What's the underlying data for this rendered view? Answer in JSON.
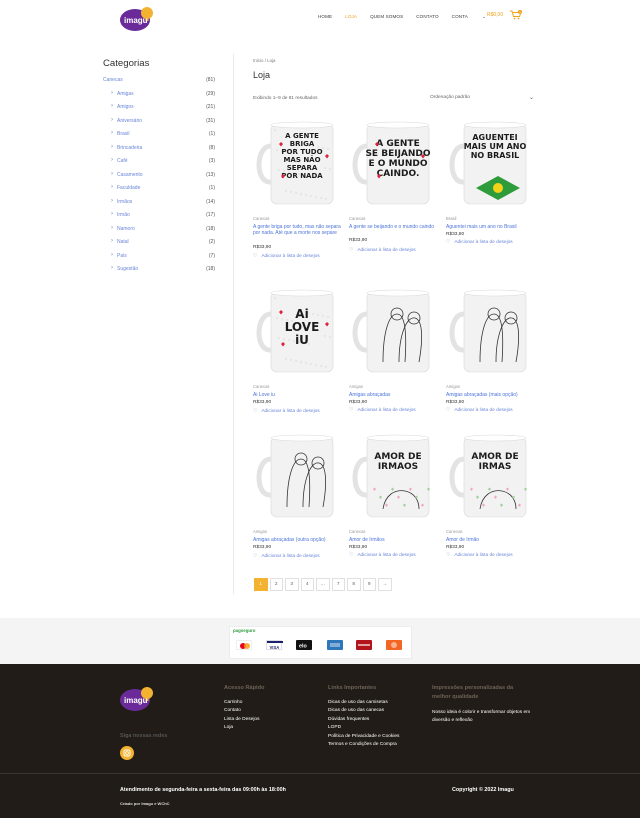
{
  "header": {
    "logo_text": "imagu",
    "nav": [
      "HOME",
      "LOJA",
      "QUEM SOMOS",
      "CONTATO",
      "CONTA"
    ],
    "cart_total": "R$0,00",
    "cart_count": "0"
  },
  "sidebar": {
    "title": "Categorias",
    "items": [
      {
        "label": "Canecas",
        "count": "(81)",
        "sub": false
      },
      {
        "label": "Amigas",
        "count": "(29)",
        "sub": true
      },
      {
        "label": "Amigos",
        "count": "(21)",
        "sub": true
      },
      {
        "label": "Aniversário",
        "count": "(31)",
        "sub": true
      },
      {
        "label": "Brasil",
        "count": "(1)",
        "sub": true
      },
      {
        "label": "Brincadeira",
        "count": "(8)",
        "sub": true
      },
      {
        "label": "Café",
        "count": "(3)",
        "sub": true
      },
      {
        "label": "Casamento",
        "count": "(13)",
        "sub": true
      },
      {
        "label": "Faculdade",
        "count": "(1)",
        "sub": true
      },
      {
        "label": "Irmãos",
        "count": "(14)",
        "sub": true
      },
      {
        "label": "Irmão",
        "count": "(17)",
        "sub": true
      },
      {
        "label": "Namoro",
        "count": "(18)",
        "sub": true
      },
      {
        "label": "Natal",
        "count": "(2)",
        "sub": true
      },
      {
        "label": "Pais",
        "count": "(7)",
        "sub": true
      },
      {
        "label": "Sugestão",
        "count": "(18)",
        "sub": true
      }
    ]
  },
  "main": {
    "breadcrumb": "Início / Loja",
    "title": "Loja",
    "results": "Exibindo 1–9 de 81 resultados",
    "ordering": "Ordenação padrão",
    "wishlist_label": "Adicionar à lista de desejos",
    "products": [
      {
        "cat": "Canecas",
        "name": "A gente briga por tudo, mas não separa por nada. Até que a morte nos separe",
        "price": "R$33,90",
        "mug_text": [
          "A GENTE",
          "BRIGA",
          "POR TUDO",
          "MAS NÃO",
          "SEPARA",
          "POR NADA"
        ]
      },
      {
        "cat": "Canecas",
        "name": "A gente se beijando e o mundo caindo",
        "price": "R$33,90",
        "mug_text": [
          "A GENTE",
          "SE BEIJANDO",
          "E O MUNDO",
          "CAINDO."
        ]
      },
      {
        "cat": "Brasil",
        "name": "Aguentei mais um ano no Brasil",
        "price": "R$33,90",
        "mug_text": [
          "AGUENTEI",
          "MAIS UM ANO",
          "NO BRASIL"
        ]
      },
      {
        "cat": "Canecas",
        "name": "Ai Love iu",
        "price": "R$33,90",
        "mug_text": [
          "Ai",
          "LOVE",
          "iU"
        ]
      },
      {
        "cat": "Amigas",
        "name": "Amigas abraçadas",
        "price": "R$33,90",
        "mug_text": []
      },
      {
        "cat": "Amigas",
        "name": "Amigas abraçadas (mais opção)",
        "price": "R$33,90",
        "mug_text": []
      },
      {
        "cat": "Amigas",
        "name": "Amigas abraçadas (outra opção)",
        "price": "R$33,90",
        "mug_text": []
      },
      {
        "cat": "Canecas",
        "name": "Amor de Irmãos",
        "price": "R$33,90",
        "mug_text": [
          "AMOR DE",
          "IRMAOS"
        ]
      },
      {
        "cat": "Canecas",
        "name": "Amor de Irmão",
        "price": "R$33,90",
        "mug_text": [
          "AMOR DE",
          "IRMAS"
        ]
      }
    ],
    "pages": [
      "1",
      "2",
      "3",
      "4",
      "…",
      "7",
      "8",
      "9",
      "→"
    ]
  },
  "payment": {
    "provider": "pagseguro",
    "cards": [
      "mastercard",
      "VISA",
      "elo",
      "amex",
      "hipercard",
      "diners"
    ]
  },
  "footer": {
    "follow": "Siga nossas redes",
    "quick_title": "Acesso Rápido",
    "quick_links": [
      "Carrinho",
      "Contato",
      "Lista de Desejos",
      "Loja"
    ],
    "important_title": "Links Importantes",
    "important_links": [
      "Dicas de uso das camisetas",
      "Dicas de uso das canecas",
      "Dúvidas frequentes",
      "LGPD",
      "Política de Privacidade e Cookies",
      "Termos e Condições de Compra"
    ],
    "about_title": "Impressões personalizadas da melhor qualidade",
    "about_text": "Nosso ideia é colorir e transformar objetos em diversão e reflexão",
    "attendance": "Atendimento de segunda-feira a sexta-feira das 09:00h às 18:00h",
    "copyright": "Copyright © 2022 Imagu",
    "credit": "Criado por Imagu e WChC"
  },
  "colors": {
    "accent": "#f3b230",
    "link": "#4b74d8",
    "footer_bg": "#211c17"
  }
}
